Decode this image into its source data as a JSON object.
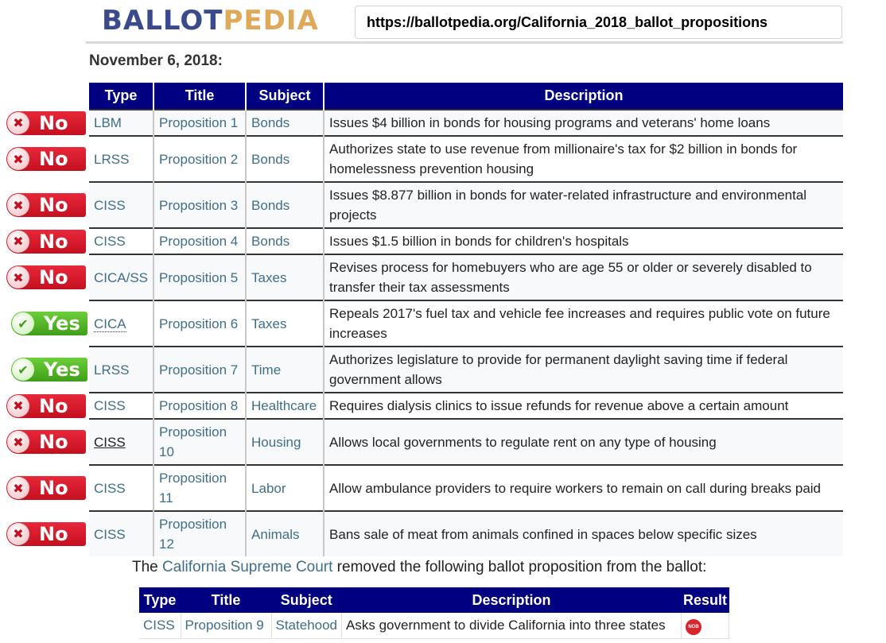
{
  "header": {
    "logo_part1": "BALLOT",
    "logo_part2": "PEDIA",
    "url": "https://ballotpedia.org/California_2018_ballot_propositions"
  },
  "date_heading": "November 6, 2018:",
  "main_table": {
    "columns": [
      "Type",
      "Title",
      "Subject",
      "Description"
    ],
    "rows": [
      {
        "result": "No",
        "type": "LBM",
        "title": "Proposition 1",
        "subject": "Bonds",
        "description": "Issues $4 billion in bonds for housing programs and veterans' home loans"
      },
      {
        "result": "No",
        "type": "LRSS",
        "title": "Proposition 2",
        "subject": "Bonds",
        "description": "Authorizes state to use revenue from millionaire's tax for $2 billion in bonds for homelessness prevention housing"
      },
      {
        "result": "No",
        "type": "CISS",
        "title": "Proposition 3",
        "subject": "Bonds",
        "description": "Issues $8.877 billion in bonds for water-related infrastructure and environmental projects"
      },
      {
        "result": "No",
        "type": "CISS",
        "title": "Proposition 4",
        "subject": "Bonds",
        "description": "Issues $1.5 billion in bonds for children's hospitals"
      },
      {
        "result": "No",
        "type": "CICA/SS",
        "title": "Proposition 5",
        "subject": "Taxes",
        "description": "Revises process for homebuyers who are age 55 or older or severely disabled to transfer their tax assessments"
      },
      {
        "result": "Yes",
        "type": "CICA",
        "title": "Proposition 6",
        "subject": "Taxes",
        "description": "Repeals 2017's fuel tax and vehicle fee increases and requires public vote on future increases"
      },
      {
        "result": "Yes",
        "type": "LRSS",
        "title": "Proposition 7",
        "subject": "Time",
        "description": "Authorizes legislature to provide for permanent daylight saving time if federal government allows"
      },
      {
        "result": "No",
        "type": "CISS",
        "title": "Proposition 8",
        "subject": "Healthcare",
        "description": "Requires dialysis clinics to issue refunds for revenue above a certain amount"
      },
      {
        "result": "No",
        "type": "CISS",
        "title": "Proposition 10",
        "subject": "Housing",
        "description": "Allows local governments to regulate rent on any type of housing"
      },
      {
        "result": "No",
        "type": "CISS",
        "title": "Proposition 11",
        "subject": "Labor",
        "description": "Allow ambulance providers to require workers to remain on call during breaks paid"
      },
      {
        "result": "No",
        "type": "CISS",
        "title": "Proposition 12",
        "subject": "Animals",
        "description": "Bans sale of meat from animals confined in spaces below specific sizes"
      }
    ]
  },
  "removed_note": {
    "prefix": "The ",
    "link": "California Supreme Court",
    "suffix": " removed the following ballot proposition from the ballot:"
  },
  "removed_table": {
    "columns": [
      "Type",
      "Title",
      "Subject",
      "Description",
      "Result"
    ],
    "rows": [
      {
        "type": "CISS",
        "title": "Proposition 9",
        "subject": "Statehood",
        "description": "Asks government to divide California into three states",
        "result_icon": "NOB"
      }
    ]
  },
  "colors": {
    "header_bg": "#000080",
    "link": "#3f6e8a",
    "no_badge": "#d61a2b",
    "yes_badge": "#52b626",
    "logo_blue": "#3a4a8c",
    "logo_gold": "#e0a95a"
  }
}
